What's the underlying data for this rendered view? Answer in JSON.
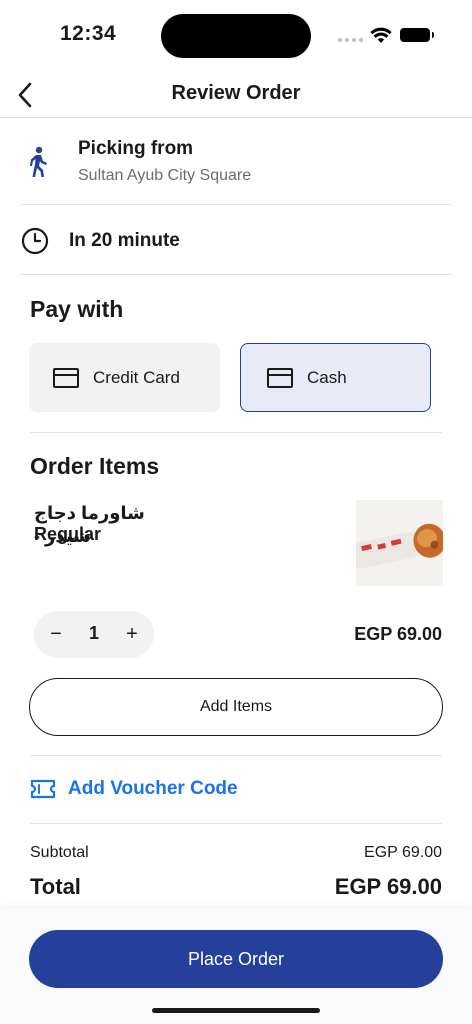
{
  "status_bar": {
    "time": "12:34"
  },
  "header": {
    "title": "Review Order"
  },
  "pickup": {
    "title": "Picking from",
    "location": "Sultan Ayub City Square"
  },
  "timing": {
    "label": "In 20 minute"
  },
  "payment": {
    "title": "Pay with",
    "options": [
      {
        "label": "Credit Card",
        "selected": false
      },
      {
        "label": "Cash",
        "selected": true
      }
    ]
  },
  "order_items": {
    "title": "Order Items",
    "items": [
      {
        "name": "شاورما دجاج شيدر -",
        "size": "Regular",
        "quantity": "1",
        "price": "EGP 69.00"
      }
    ]
  },
  "add_items_label": "Add Items",
  "voucher_label": "Add Voucher Code",
  "summary": {
    "subtotal_label": "Subtotal",
    "subtotal_value": "EGP 69.00",
    "total_label": "Total",
    "total_value": "EGP 69.00"
  },
  "place_order_label": "Place Order",
  "colors": {
    "primary": "#24409a",
    "link": "#1a73e8",
    "selected_bg": "#e8ebf6"
  }
}
